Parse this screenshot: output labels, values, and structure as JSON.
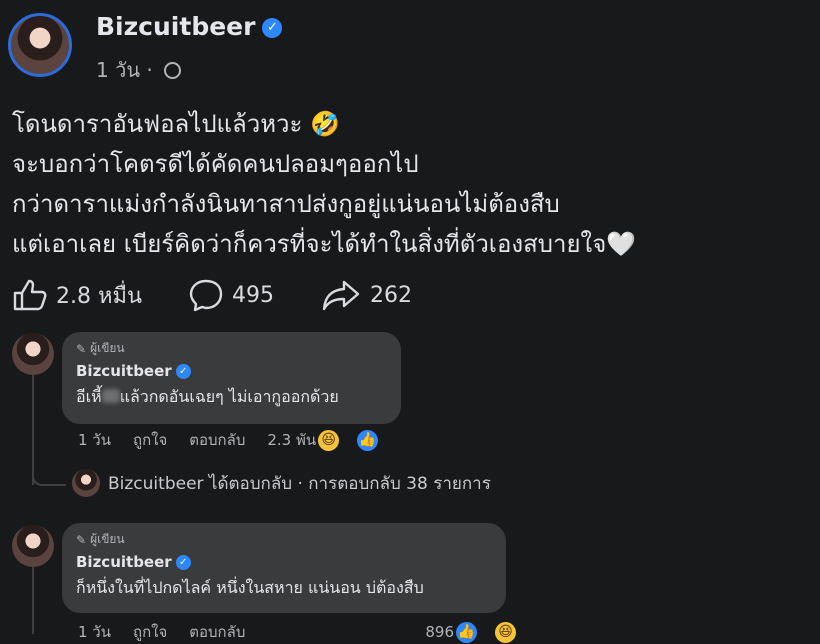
{
  "post": {
    "author": "Bizcuitbeer",
    "time": "1 วัน",
    "separator": "·",
    "lines": [
      "โดนดาราอันฟอลไปแล้วหวะ 🤣",
      "จะบอกว่าโคตรดีได้คัดคนปลอมๆออกไป",
      "กว่าดาราแม่งกำลังนินทาสาปส่งกูอยู่แน่นอนไม่ต้องสืบ",
      "แต่เอาเลย เบียร์คิดว่าก็ควรที่จะได้ทำในสิ่งที่ตัวเองสบายใจ🤍"
    ],
    "reactions": "2.8 หมื่น",
    "comments": "495",
    "shares": "262"
  },
  "comments": [
    {
      "role": "ผู้เขียน",
      "name": "Bizcuitbeer",
      "text_before": "อีเหี้",
      "text_after": "แล้วกดอันเฉยๆ ไม่เอากูออกด้วย",
      "time": "1 วัน",
      "like": "ถูกใจ",
      "reply": "ตอบกลับ",
      "reaction_count": "2.3 พัน"
    },
    {
      "role": "ผู้เขียน",
      "name": "Bizcuitbeer",
      "text": "ก็หนึ่งในที่ไปกดไลค์ หนึ่งในสหาย แน่นอน บ่ต้องสืบ",
      "time": "1 วัน",
      "like": "ถูกใจ",
      "reply": "ตอบกลับ",
      "reaction_count": "896"
    }
  ],
  "reply_summary": "Bizcuitbeer ได้ตอบกลับ · การตอบกลับ 38 รายการ",
  "colors": {
    "background": "#18191a",
    "bubble": "#3a3b3c",
    "verified": "#2d88ff",
    "secondary_text": "#b0b3b8"
  }
}
